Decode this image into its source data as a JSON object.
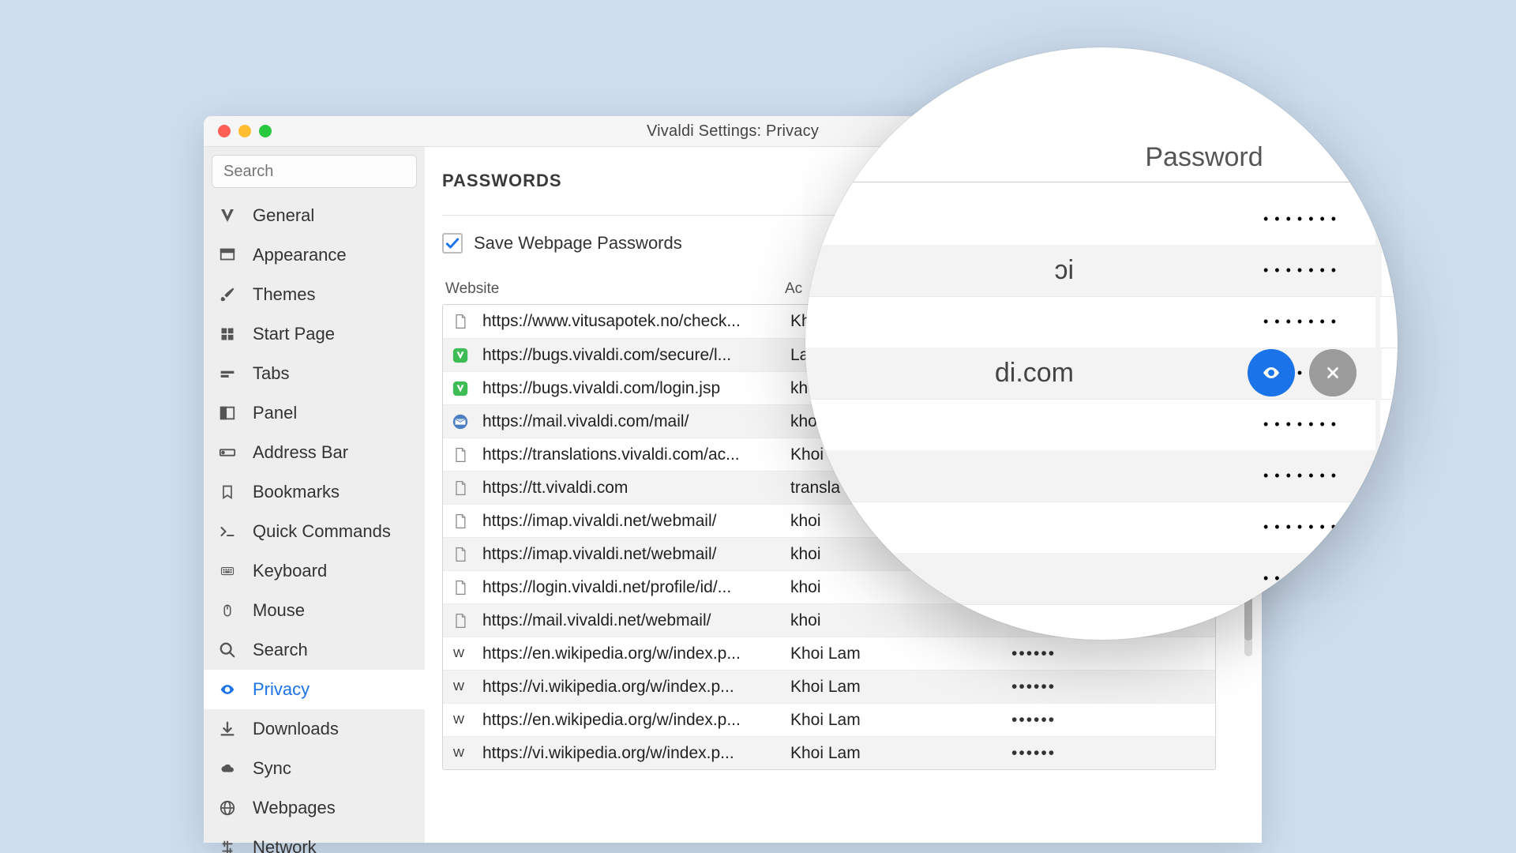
{
  "window": {
    "title": "Vivaldi Settings: Privacy"
  },
  "search": {
    "placeholder": "Search"
  },
  "sidebar": {
    "items": [
      {
        "label": "General",
        "icon": "vivaldi-icon"
      },
      {
        "label": "Appearance",
        "icon": "appearance-icon"
      },
      {
        "label": "Themes",
        "icon": "brush-icon"
      },
      {
        "label": "Start Page",
        "icon": "grid-icon"
      },
      {
        "label": "Tabs",
        "icon": "tabs-icon"
      },
      {
        "label": "Panel",
        "icon": "panel-icon"
      },
      {
        "label": "Address Bar",
        "icon": "addressbar-icon"
      },
      {
        "label": "Bookmarks",
        "icon": "bookmark-icon"
      },
      {
        "label": "Quick Commands",
        "icon": "terminal-icon"
      },
      {
        "label": "Keyboard",
        "icon": "keyboard-icon"
      },
      {
        "label": "Mouse",
        "icon": "mouse-icon"
      },
      {
        "label": "Search",
        "icon": "search-icon"
      },
      {
        "label": "Privacy",
        "icon": "eye-icon",
        "active": true
      },
      {
        "label": "Downloads",
        "icon": "download-icon"
      },
      {
        "label": "Sync",
        "icon": "cloud-icon"
      },
      {
        "label": "Webpages",
        "icon": "globe-icon"
      },
      {
        "label": "Network",
        "icon": "network-icon"
      }
    ]
  },
  "section": {
    "title": "PASSWORDS",
    "save_label": "Save Webpage Passwords",
    "save_checked": true,
    "columns": {
      "website": "Website",
      "account": "Ac",
      "password": "Password"
    }
  },
  "rows": [
    {
      "favicon": "file-icon",
      "website": "https://www.vitusapotek.no/check...",
      "account": "Kh",
      "password": "••••••"
    },
    {
      "favicon": "vivaldi-green-icon",
      "website": "https://bugs.vivaldi.com/secure/l...",
      "account": "La",
      "password": "••••••"
    },
    {
      "favicon": "vivaldi-green-icon",
      "website": "https://bugs.vivaldi.com/login.jsp",
      "account": "kh",
      "password": "••••••"
    },
    {
      "favicon": "mail-icon",
      "website": "https://mail.vivaldi.com/mail/",
      "account": "kho",
      "password": "••••••"
    },
    {
      "favicon": "file-icon",
      "website": "https://translations.vivaldi.com/ac...",
      "account": "Khoi",
      "password": "••••••"
    },
    {
      "favicon": "file-icon",
      "website": "https://tt.vivaldi.com",
      "account": "transla",
      "password": "••••••"
    },
    {
      "favicon": "file-icon",
      "website": "https://imap.vivaldi.net/webmail/",
      "account": "khoi",
      "password": "••••••"
    },
    {
      "favicon": "file-icon",
      "website": "https://imap.vivaldi.net/webmail/",
      "account": "khoi",
      "password": "••••••"
    },
    {
      "favicon": "file-icon",
      "website": "https://login.vivaldi.net/profile/id/...",
      "account": "khoi",
      "password": "••••••"
    },
    {
      "favicon": "file-icon",
      "website": "https://mail.vivaldi.net/webmail/",
      "account": "khoi",
      "password": "••••••"
    },
    {
      "favicon": "wikipedia-icon",
      "website": "https://en.wikipedia.org/w/index.p...",
      "account": "Khoi Lam",
      "password": "••••••"
    },
    {
      "favicon": "wikipedia-icon",
      "website": "https://vi.wikipedia.org/w/index.p...",
      "account": "Khoi Lam",
      "password": "••••••"
    },
    {
      "favicon": "wikipedia-icon",
      "website": "https://en.wikipedia.org/w/index.p...",
      "account": "Khoi Lam",
      "password": "••••••"
    },
    {
      "favicon": "wikipedia-icon",
      "website": "https://vi.wikipedia.org/w/index.p...",
      "account": "Khoi Lam",
      "password": "••••••"
    }
  ],
  "zoom": {
    "password_header": "Password",
    "rows": [
      {
        "acct": "",
        "dots": "•••••••"
      },
      {
        "acct": "ɔi",
        "dots": "•••••••"
      },
      {
        "acct": "",
        "dots": "•••••••"
      },
      {
        "acct": "di.com",
        "dots": "•••••",
        "selected": true
      },
      {
        "acct": "",
        "dots": "•••••••"
      },
      {
        "acct": "",
        "dots": "•••••••"
      },
      {
        "acct": "",
        "dots": "•••••••"
      },
      {
        "acct": "",
        "dots": "•••••••"
      },
      {
        "acct": "",
        "dots": "•••••••"
      }
    ]
  }
}
